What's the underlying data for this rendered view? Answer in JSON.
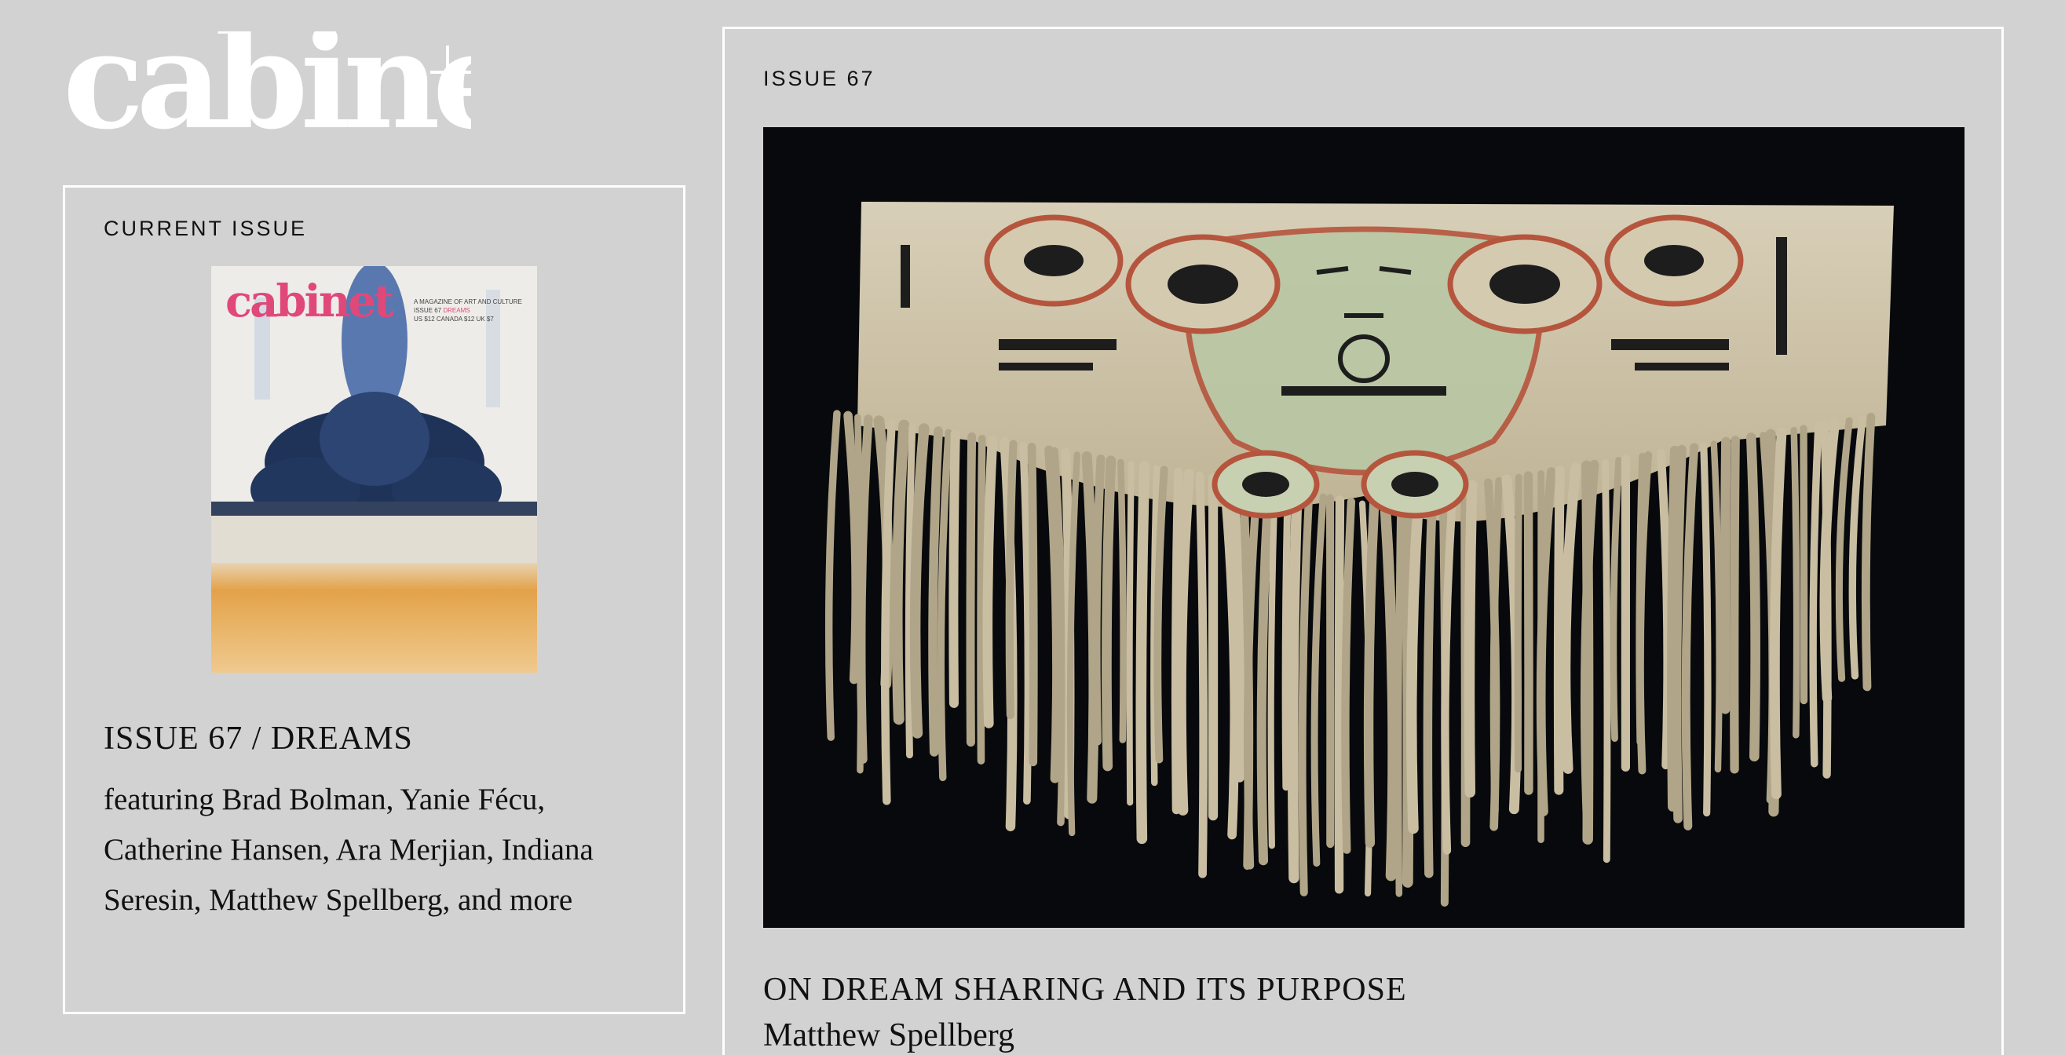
{
  "site": {
    "logo_text": "cabinet"
  },
  "current_issue": {
    "kicker": "CURRENT ISSUE",
    "cover": {
      "logo_text": "cabinet",
      "tagline": "A MAGAZINE OF ART AND CULTURE",
      "issue_label": "ISSUE 67",
      "theme": "DREAMS",
      "prices": "US $12   CANADA $12   UK $7"
    },
    "title": "ISSUE 67 / DREAMS",
    "description": "featuring Brad Bolman, Yanie Fécu, Catherine Hansen, Ara Merjian, Indiana Seresin, Matthew Spellberg, and more"
  },
  "feature": {
    "kicker": "ISSUE 67",
    "image_subject": "painted hide apron with fringe",
    "title": "ON DREAM SHARING AND ITS PURPOSE",
    "author": "Matthew Spellberg"
  },
  "colors": {
    "background": "#d2d2d2",
    "panel_border": "#ffffff",
    "cover_logo": "#e0487a"
  }
}
